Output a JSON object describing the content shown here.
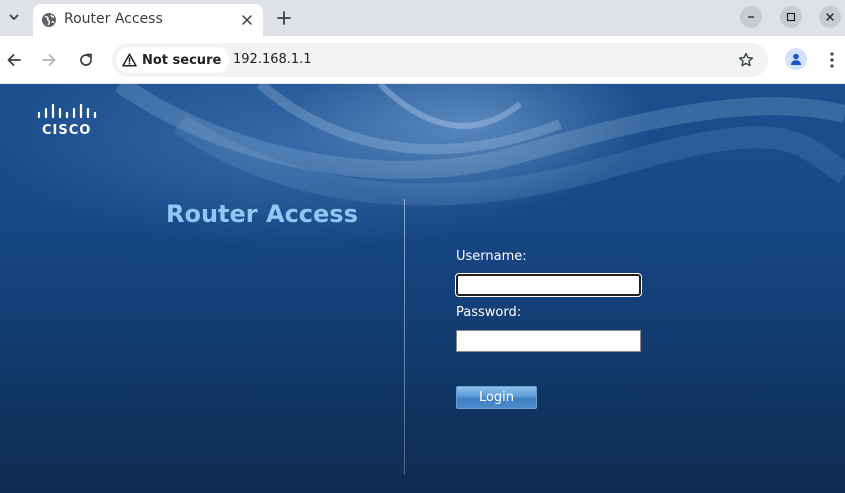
{
  "browser": {
    "tab": {
      "title": "Router Access",
      "favicon": "globe-icon"
    },
    "security_label": "Not secure",
    "url": "192.168.1.1",
    "icons": {
      "tab_list": "chevron-down-icon",
      "tab_close": "close-icon",
      "new_tab": "plus-icon",
      "back": "arrow-left-icon",
      "forward": "arrow-right-icon",
      "reload": "reload-icon",
      "security": "warning-icon",
      "bookmark": "star-icon",
      "profile": "person-icon",
      "menu": "kebab-menu-icon"
    }
  },
  "page": {
    "logo_text": "CISCO",
    "title": "Router Access",
    "form": {
      "username_label": "Username:",
      "username_value": "",
      "password_label": "Password:",
      "password_value": "",
      "login_label": "Login"
    }
  },
  "colors": {
    "page_background": "#184a8a",
    "title_color": "#8ec8f4",
    "tabstrip": "#dee1e6",
    "button_accent": "#4c8ccd"
  }
}
